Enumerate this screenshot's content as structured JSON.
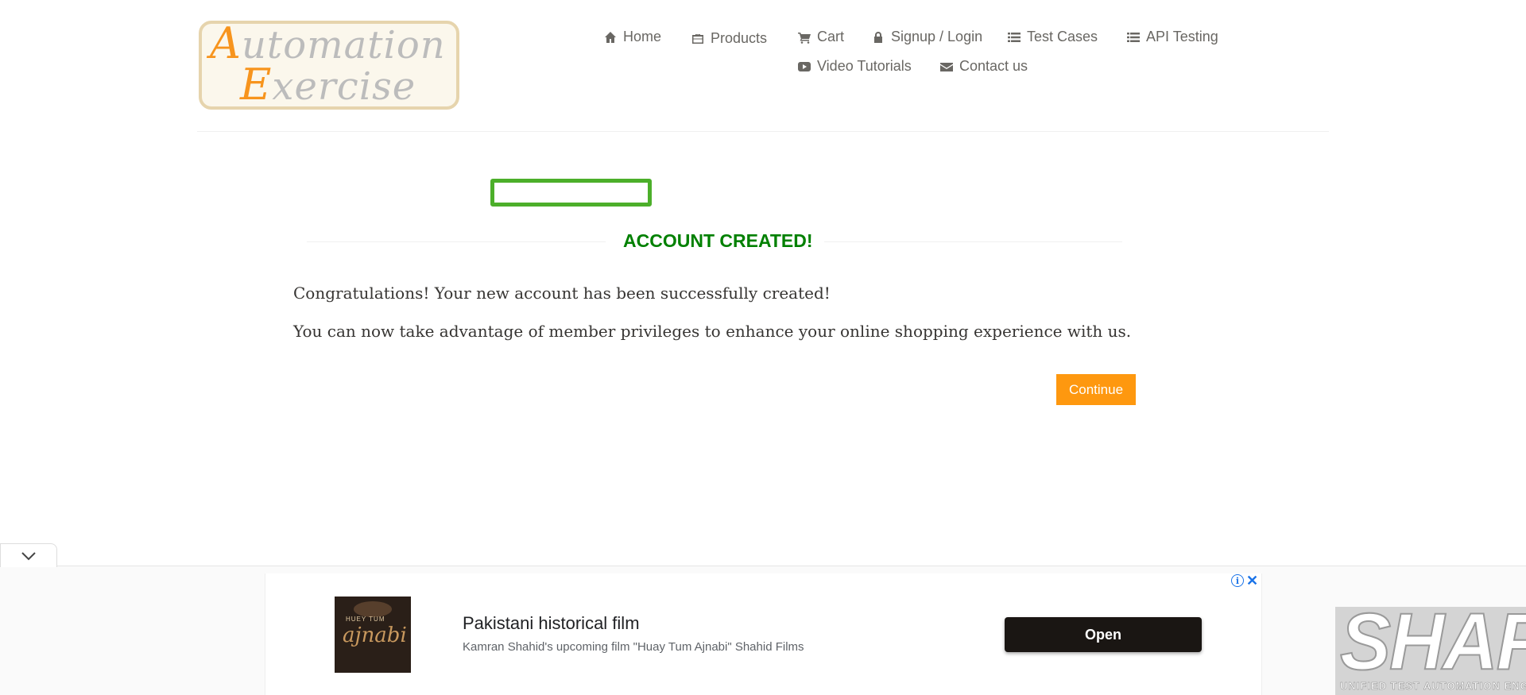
{
  "logo": {
    "line1_cap": "A",
    "line1_rest": "utomation",
    "line2_cap": "E",
    "line2_rest": "xercise"
  },
  "nav": {
    "home": {
      "label": "Home",
      "icon": "home-icon"
    },
    "products": {
      "label": "Products",
      "icon": "briefcase-icon"
    },
    "cart": {
      "label": "Cart",
      "icon": "cart-icon"
    },
    "signup_login": {
      "label": "Signup / Login",
      "icon": "lock-icon"
    },
    "test_cases": {
      "label": "Test Cases",
      "icon": "list-icon"
    },
    "api_testing": {
      "label": "API Testing",
      "icon": "list-icon"
    },
    "video_tutorials": {
      "label": "Video Tutorials",
      "icon": "youtube-play-icon"
    },
    "contact_us": {
      "label": "Contact us",
      "icon": "envelope-icon"
    }
  },
  "main": {
    "title": "ACCOUNT CREATED!",
    "message1": "Congratulations! Your new account has been successfully created!",
    "message2": "You can now take advantage of member privileges to enhance your online shopping experience with us.",
    "continue_label": "Continue"
  },
  "ad": {
    "thumb_small": "HUEY TUM",
    "thumb_big": "ajnabi",
    "title": "Pakistani historical film",
    "subtitle": "Kamran Shahid's upcoming film \"Huay Tum Ajnabi\" Shahid Films",
    "open_label": "Open",
    "info_glyph": "i",
    "close_glyph": "✕"
  },
  "watermark": {
    "main": "SHAFT",
    "sub": "UNIFIED TEST AUTOMATION ENGINE"
  },
  "colors": {
    "accent": "#fe980f",
    "success": "#008000",
    "highlight_box": "#4caf2a",
    "nav_text": "#696763",
    "ad_button": "#1a1613",
    "ad_link": "#1a73e8"
  }
}
